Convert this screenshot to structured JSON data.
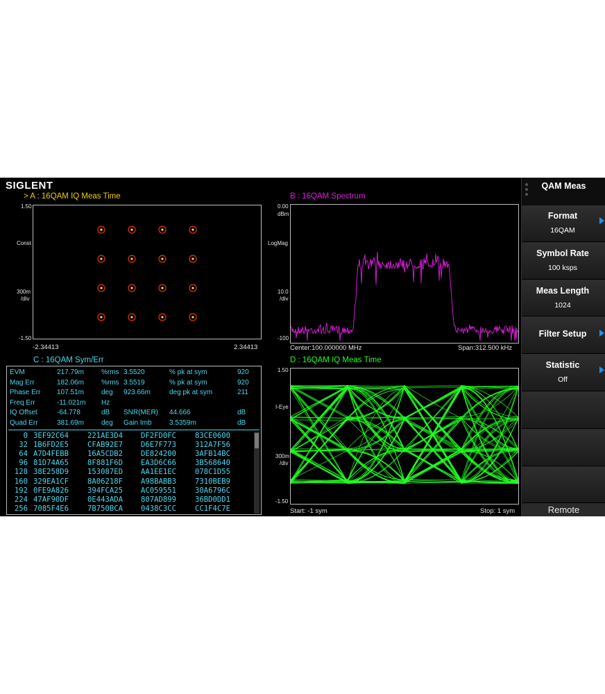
{
  "brand": "SIGLENT",
  "panelA": {
    "title": ">  A :  16QAM  IQ Meas Time",
    "y_top": "1.50",
    "y_mode": "Const",
    "y_scale1": "300m",
    "y_scale2": "/div",
    "y_bottom": "-1.50",
    "x_left": "-2.34413",
    "x_right": "2.34413",
    "color": "#f0d000"
  },
  "panelB": {
    "title": "B :  16QAM  Spectrum",
    "y_top1": "0.00",
    "y_top2": "dBm",
    "y_mode": "LogMag",
    "y_scale1": "10.0",
    "y_scale2": "/div",
    "y_bottom": "-100",
    "center": "Center:100.000000 MHz",
    "span": "Span:312.500 kHz",
    "color": "#e01ee0"
  },
  "panelC": {
    "title": "C :  16QAM  Sym/Err",
    "color": "#49d8ee",
    "stats": [
      [
        "EVM",
        "217.79m",
        "%rms",
        "3.5520",
        "% pk at sym",
        "920"
      ],
      [
        "Mag Err",
        "182.06m",
        "%rms",
        "3.5519",
        "% pk at sym",
        "920"
      ],
      [
        "Phase Err",
        "107.51m",
        "deg",
        "923.66m",
        "deg pk at sym",
        "211"
      ],
      [
        "Freq Err",
        "-11.021m",
        "Hz",
        "",
        "",
        ""
      ],
      [
        "IQ Offset",
        "-64.778",
        "dB",
        "SNR(MER)",
        "44.666",
        "dB"
      ],
      [
        "Quad Err",
        "381.69m",
        "deg",
        "Gain Imb",
        "3.5359m",
        "dB"
      ]
    ],
    "symbols": [
      {
        "idx": "0",
        "w": [
          "3EF92C64",
          "221AE3D4",
          "DF2FD0FC",
          "83CE0600"
        ]
      },
      {
        "idx": "32",
        "w": [
          "1B6FD2E5",
          "CFAB92E7",
          "D6E7F773",
          "312A7F56"
        ]
      },
      {
        "idx": "64",
        "w": [
          "A7D4FEBB",
          "16A5CDB2",
          "DE824200",
          "3AFB14BC"
        ]
      },
      {
        "idx": "96",
        "w": [
          "81D74A65",
          "8F881F6D",
          "EA3D6C66",
          "3B568640"
        ]
      },
      {
        "idx": "128",
        "w": [
          "38E258D9",
          "153087ED",
          "AA1EE1EC",
          "078C1D55"
        ]
      },
      {
        "idx": "160",
        "w": [
          "329EA1CF",
          "8A06218F",
          "A98BABB3",
          "7310BEB9"
        ]
      },
      {
        "idx": "192",
        "w": [
          "0FE9A826",
          "394FCA25",
          "AC059551",
          "30A6796C"
        ]
      },
      {
        "idx": "224",
        "w": [
          "47AF90DF",
          "0E443ADA",
          "807AD899",
          "36BD0DD1"
        ]
      },
      {
        "idx": "256",
        "w": [
          "7085F4E6",
          "7B750BCA",
          "0438C3CC",
          "CC1F4C7E"
        ]
      }
    ]
  },
  "panelD": {
    "title": "D :  16QAM  IQ Meas Time",
    "y_top": "1.50",
    "y_mode": "I-Eye",
    "y_scale1": "300m",
    "y_scale2": "/div",
    "y_bottom": "-1.50",
    "start": "Start: -1 sym",
    "stop": "Stop: 1 sym",
    "color": "#22ff22"
  },
  "sidebar": {
    "header": "QAM Meas",
    "items": [
      {
        "label": "Format",
        "value": "16QAM",
        "arrow": true
      },
      {
        "label": "Symbol Rate",
        "value": "100 ksps",
        "arrow": false
      },
      {
        "label": "Meas Length",
        "value": "1024",
        "arrow": false
      },
      {
        "label": "Filter Setup",
        "value": "",
        "arrow": true
      },
      {
        "label": "Statistic",
        "value": "Off",
        "arrow": true
      }
    ],
    "footer": "Remote"
  }
}
